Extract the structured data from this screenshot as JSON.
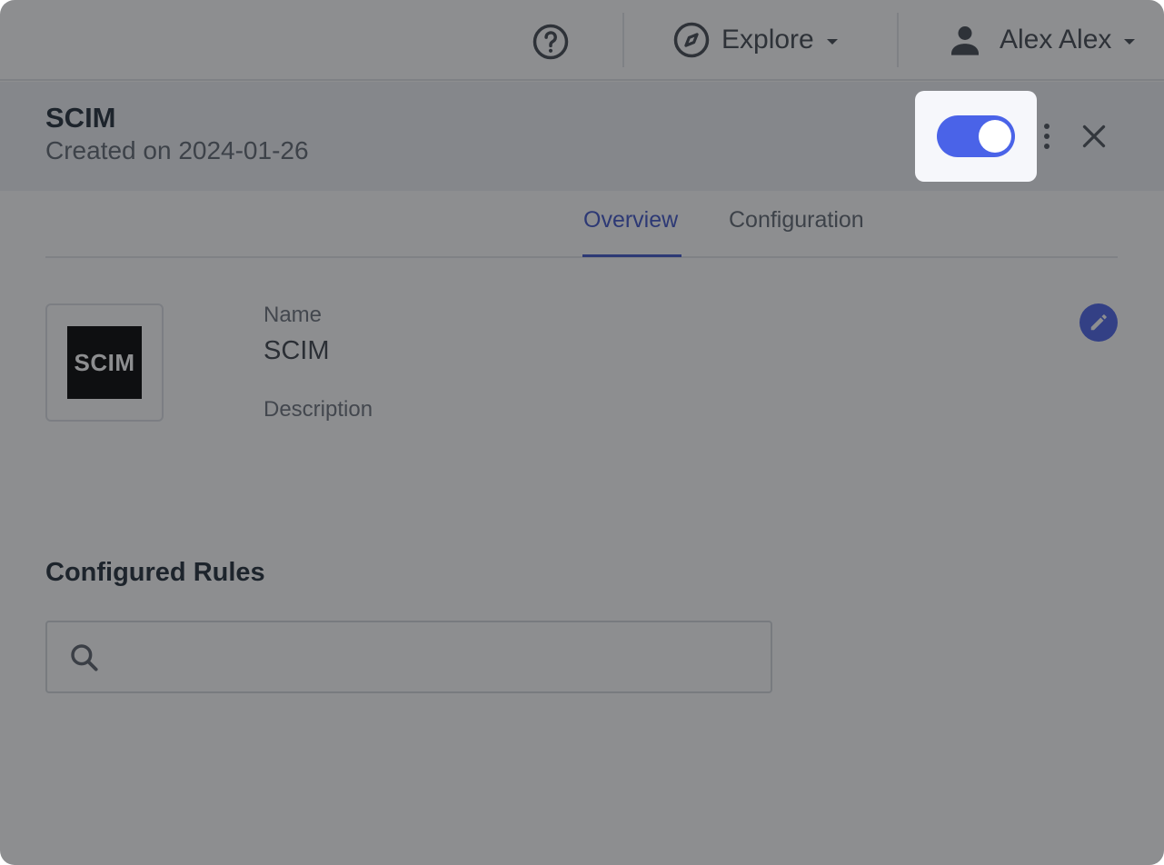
{
  "topbar": {
    "help_icon": "help-circle-icon",
    "explore_label": "Explore",
    "explore_icon": "compass-icon",
    "user_label": "Alex Alex",
    "user_icon": "person-icon"
  },
  "header": {
    "title": "SCIM",
    "subtitle": "Created on 2024-01-26",
    "toggle_enabled": true
  },
  "tabs": [
    {
      "label": "Overview",
      "active": true
    },
    {
      "label": "Configuration",
      "active": false
    }
  ],
  "overview": {
    "logo_text": "SCIM",
    "name_label": "Name",
    "name_value": "SCIM",
    "description_label": "Description"
  },
  "rules": {
    "title": "Configured Rules",
    "search_placeholder": "",
    "search_value": ""
  },
  "colors": {
    "accent": "#4a63e8",
    "title": "#1f2a36"
  }
}
